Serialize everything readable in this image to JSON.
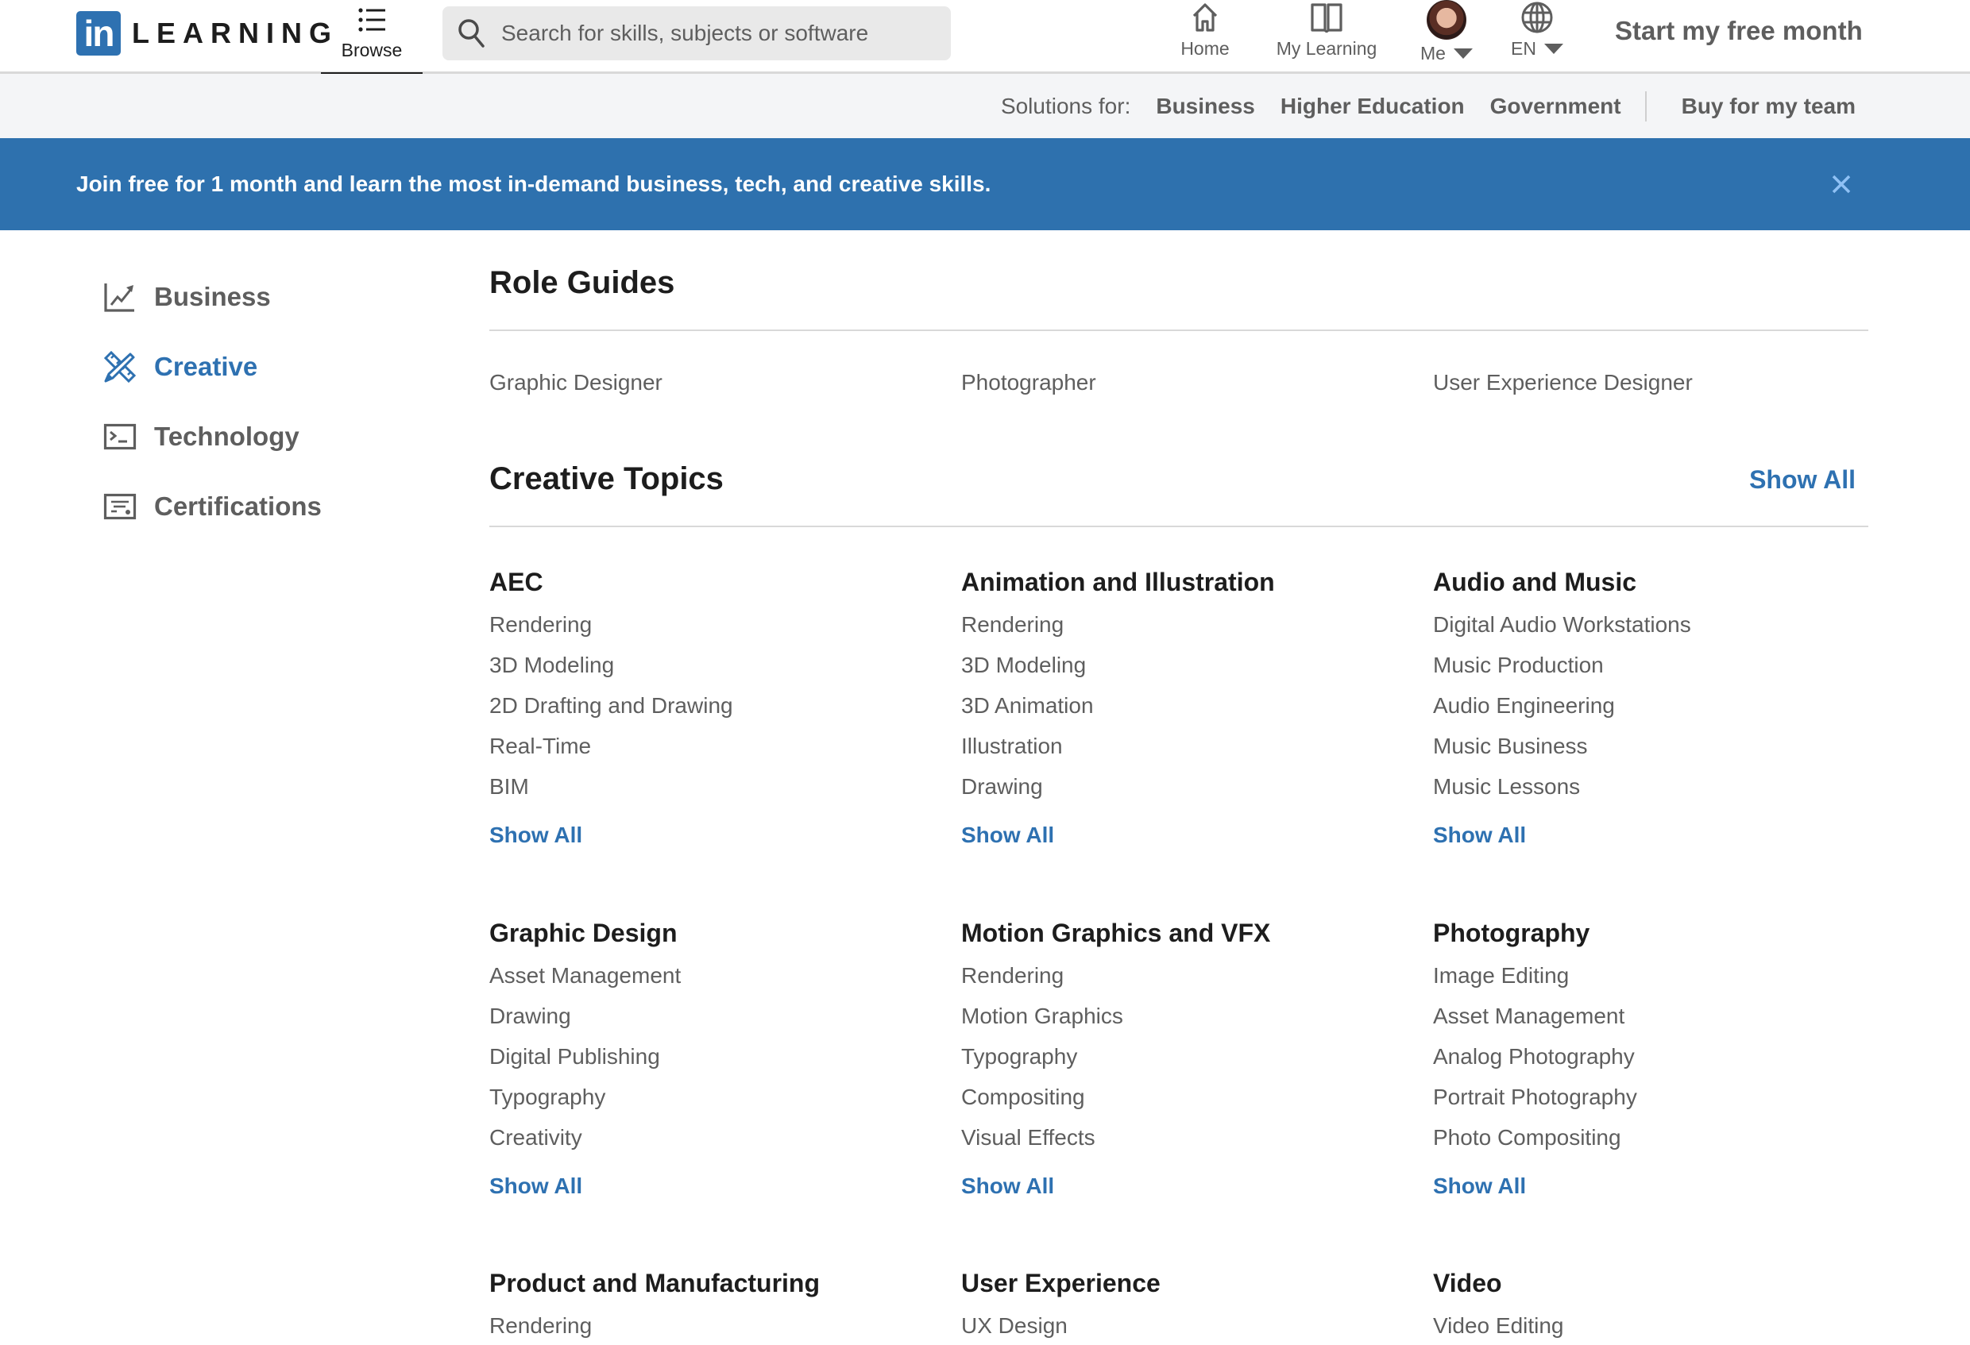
{
  "header": {
    "logo_in": "in",
    "logo_text": "LEARNING",
    "browse_label": "Browse",
    "search_placeholder": "Search for skills, subjects or software",
    "search_value": "",
    "nav": {
      "home": "Home",
      "my_learning": "My Learning",
      "me": "Me",
      "language": "EN"
    },
    "cta": "Start my free month"
  },
  "subnav": {
    "label": "Solutions for:",
    "links": [
      "Business",
      "Higher Education",
      "Government"
    ],
    "buy": "Buy for my team"
  },
  "banner": {
    "text": "Join free for 1 month and learn the most in-demand business, tech, and creative skills.",
    "color": "#2e71ae"
  },
  "sidebar": {
    "active": "Creative",
    "items": [
      {
        "label": "Business",
        "icon": "chart-trend-icon"
      },
      {
        "label": "Creative",
        "icon": "pencil-ruler-icon"
      },
      {
        "label": "Technology",
        "icon": "terminal-icon"
      },
      {
        "label": "Certifications",
        "icon": "certificate-icon"
      }
    ]
  },
  "main": {
    "role_guides": {
      "title": "Role Guides",
      "items": [
        "Graphic Designer",
        "Photographer",
        "User Experience Designer"
      ]
    },
    "topics": {
      "title": "Creative Topics",
      "show_all": "Show All",
      "show_all_label": "Show All",
      "groups": [
        {
          "heading": "AEC",
          "items": [
            "Rendering",
            "3D Modeling",
            "2D Drafting and Drawing",
            "Real-Time",
            "BIM"
          ]
        },
        {
          "heading": "Animation and Illustration",
          "items": [
            "Rendering",
            "3D Modeling",
            "3D Animation",
            "Illustration",
            "Drawing"
          ]
        },
        {
          "heading": "Audio and Music",
          "items": [
            "Digital Audio Workstations",
            "Music Production",
            "Audio Engineering",
            "Music Business",
            "Music Lessons"
          ]
        },
        {
          "heading": "Graphic Design",
          "items": [
            "Asset Management",
            "Drawing",
            "Digital Publishing",
            "Typography",
            "Creativity"
          ]
        },
        {
          "heading": "Motion Graphics and VFX",
          "items": [
            "Rendering",
            "Motion Graphics",
            "Typography",
            "Compositing",
            "Visual Effects"
          ]
        },
        {
          "heading": "Photography",
          "items": [
            "Image Editing",
            "Asset Management",
            "Analog Photography",
            "Portrait Photography",
            "Photo Compositing"
          ]
        },
        {
          "heading": "Product and Manufacturing",
          "items": [
            "Rendering"
          ]
        },
        {
          "heading": "User Experience",
          "items": [
            "UX Design"
          ]
        },
        {
          "heading": "Video",
          "items": [
            "Video Editing"
          ]
        }
      ]
    }
  },
  "colors": {
    "accent": "#2e71b1",
    "text_secondary": "#5e5e5e",
    "text_primary": "#1d1d1d",
    "subnav_bg": "#f4f5f7"
  }
}
